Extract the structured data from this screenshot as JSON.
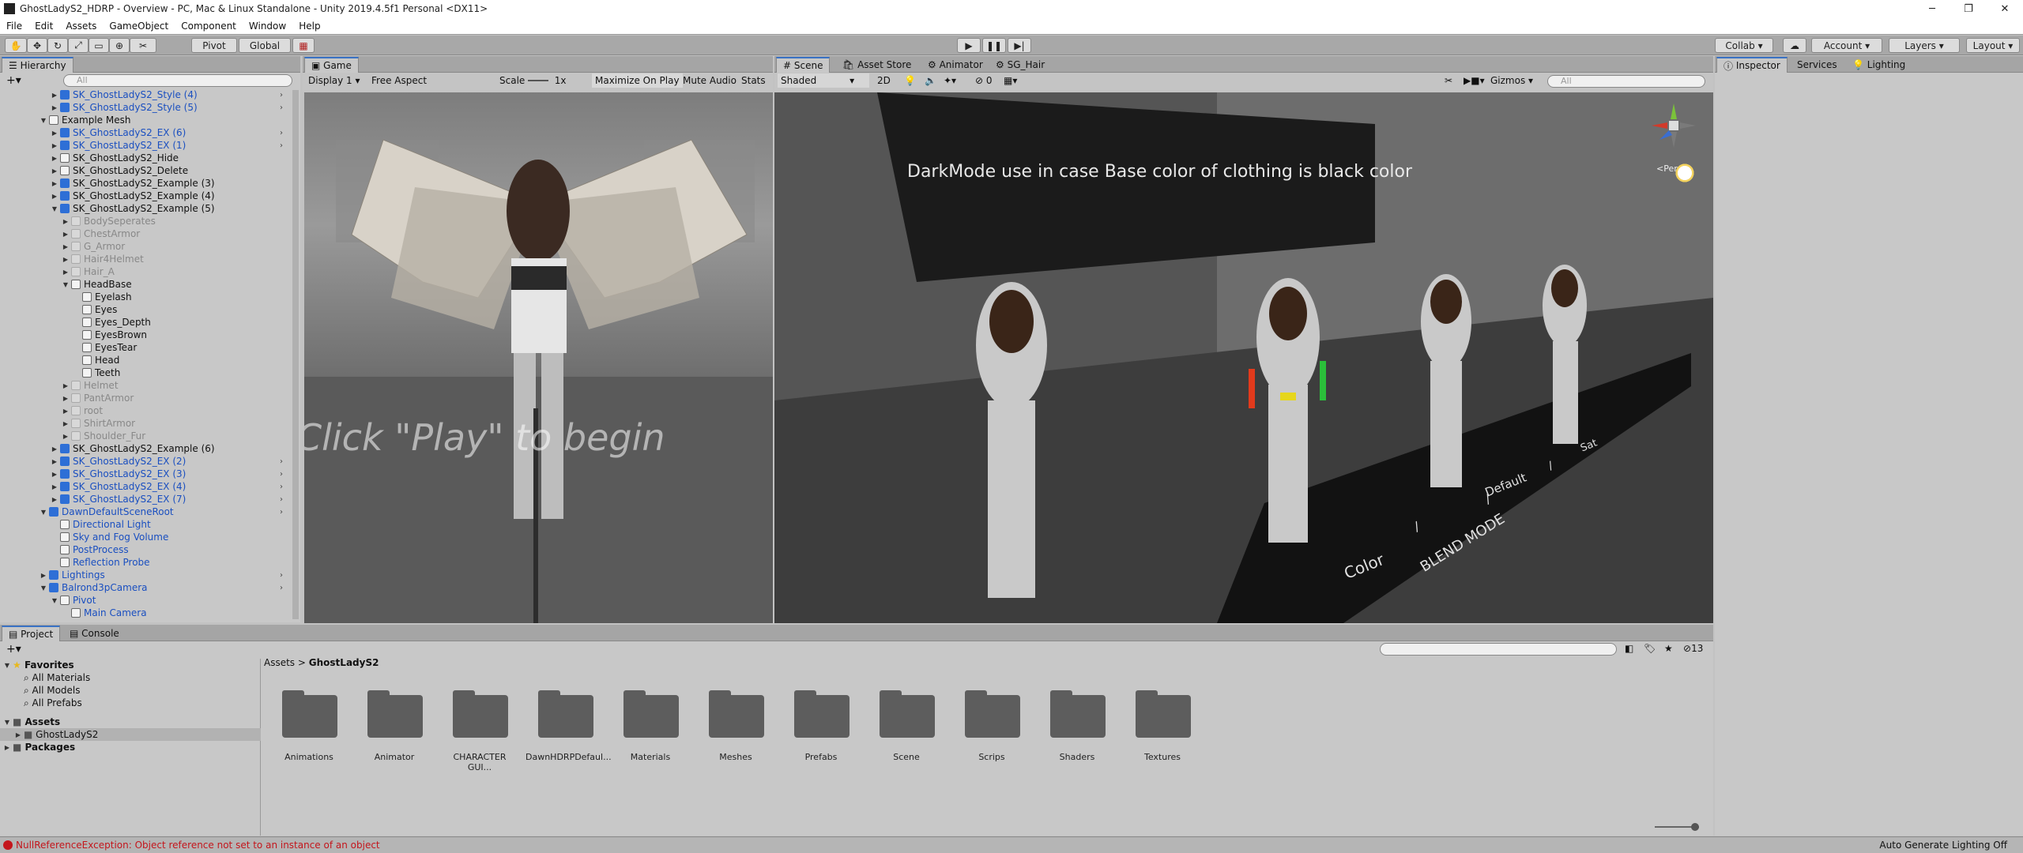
{
  "window": {
    "title": "GhostLadyS2_HDRP - Overview - PC, Mac & Linux Standalone - Unity 2019.4.5f1 Personal <DX11>",
    "controls": [
      "─",
      "❐",
      "✕"
    ]
  },
  "menu": [
    "File",
    "Edit",
    "Assets",
    "GameObject",
    "Component",
    "Window",
    "Help"
  ],
  "toolbar": {
    "pivot": "Pivot",
    "global": "Global",
    "collab": "Collab ▾",
    "account": "Account",
    "layers": "Layers",
    "layout": "Layout"
  },
  "hierarchy": {
    "tab": "Hierarchy",
    "search": "All",
    "rows": [
      {
        "label": "SK_GhostLadyS2_Style (4)",
        "indent": 1,
        "arrow": "▶",
        "color": "blue",
        "icon": "blue",
        "chev": true
      },
      {
        "label": "SK_GhostLadyS2_Style (5)",
        "indent": 1,
        "arrow": "▶",
        "color": "blue",
        "icon": "blue",
        "chev": true
      },
      {
        "label": "Example Mesh",
        "indent": 0,
        "arrow": "▼",
        "color": "black",
        "icon": "white",
        "chev": false
      },
      {
        "label": "SK_GhostLadyS2_EX (6)",
        "indent": 1,
        "arrow": "▶",
        "color": "blue",
        "icon": "blue",
        "chev": true
      },
      {
        "label": "SK_GhostLadyS2_EX (1)",
        "indent": 1,
        "arrow": "▶",
        "color": "blue",
        "icon": "blue",
        "chev": true
      },
      {
        "label": "SK_GhostLadyS2_Hide",
        "indent": 1,
        "arrow": "▶",
        "color": "black",
        "icon": "white",
        "chev": false
      },
      {
        "label": "SK_GhostLadyS2_Delete",
        "indent": 1,
        "arrow": "▶",
        "color": "black",
        "icon": "white",
        "chev": false
      },
      {
        "label": "SK_GhostLadyS2_Example (3)",
        "indent": 1,
        "arrow": "▶",
        "color": "black",
        "icon": "blue",
        "chev": false
      },
      {
        "label": "SK_GhostLadyS2_Example (4)",
        "indent": 1,
        "arrow": "▶",
        "color": "black",
        "icon": "blue",
        "chev": false
      },
      {
        "label": "SK_GhostLadyS2_Example (5)",
        "indent": 1,
        "arrow": "▼",
        "color": "black",
        "icon": "blue",
        "chev": false
      },
      {
        "label": "BodySeperates",
        "indent": 2,
        "arrow": "▶",
        "color": "grey",
        "icon": "grey",
        "chev": false
      },
      {
        "label": "ChestArmor",
        "indent": 2,
        "arrow": "▶",
        "color": "grey",
        "icon": "grey",
        "chev": false
      },
      {
        "label": "G_Armor",
        "indent": 2,
        "arrow": "▶",
        "color": "grey",
        "icon": "grey",
        "chev": false
      },
      {
        "label": "Hair4Helmet",
        "indent": 2,
        "arrow": "▶",
        "color": "grey",
        "icon": "grey",
        "chev": false
      },
      {
        "label": "Hair_A",
        "indent": 2,
        "arrow": "▶",
        "color": "grey",
        "icon": "grey",
        "chev": false
      },
      {
        "label": "HeadBase",
        "indent": 2,
        "arrow": "▼",
        "color": "black",
        "icon": "white",
        "chev": false
      },
      {
        "label": "Eyelash",
        "indent": 3,
        "arrow": "",
        "color": "black",
        "icon": "white",
        "chev": false
      },
      {
        "label": "Eyes",
        "indent": 3,
        "arrow": "",
        "color": "black",
        "icon": "white",
        "chev": false
      },
      {
        "label": "Eyes_Depth",
        "indent": 3,
        "arrow": "",
        "color": "black",
        "icon": "white",
        "chev": false
      },
      {
        "label": "EyesBrown",
        "indent": 3,
        "arrow": "",
        "color": "black",
        "icon": "white",
        "chev": false
      },
      {
        "label": "EyesTear",
        "indent": 3,
        "arrow": "",
        "color": "black",
        "icon": "white",
        "chev": false
      },
      {
        "label": "Head",
        "indent": 3,
        "arrow": "",
        "color": "black",
        "icon": "white",
        "chev": false
      },
      {
        "label": "Teeth",
        "indent": 3,
        "arrow": "",
        "color": "black",
        "icon": "white",
        "chev": false
      },
      {
        "label": "Helmet",
        "indent": 2,
        "arrow": "▶",
        "color": "grey",
        "icon": "grey",
        "chev": false
      },
      {
        "label": "PantArmor",
        "indent": 2,
        "arrow": "▶",
        "color": "grey",
        "icon": "grey",
        "chev": false
      },
      {
        "label": "root",
        "indent": 2,
        "arrow": "▶",
        "color": "grey",
        "icon": "grey",
        "chev": false
      },
      {
        "label": "ShirtArmor",
        "indent": 2,
        "arrow": "▶",
        "color": "grey",
        "icon": "grey",
        "chev": false
      },
      {
        "label": "Shoulder_Fur",
        "indent": 2,
        "arrow": "▶",
        "color": "grey",
        "icon": "grey",
        "chev": false
      },
      {
        "label": "SK_GhostLadyS2_Example (6)",
        "indent": 1,
        "arrow": "▶",
        "color": "black",
        "icon": "blue",
        "chev": false
      },
      {
        "label": "SK_GhostLadyS2_EX (2)",
        "indent": 1,
        "arrow": "▶",
        "color": "blue",
        "icon": "blue",
        "chev": true
      },
      {
        "label": "SK_GhostLadyS2_EX (3)",
        "indent": 1,
        "arrow": "▶",
        "color": "blue",
        "icon": "blue",
        "chev": true
      },
      {
        "label": "SK_GhostLadyS2_EX (4)",
        "indent": 1,
        "arrow": "▶",
        "color": "blue",
        "icon": "blue",
        "chev": true
      },
      {
        "label": "SK_GhostLadyS2_EX (7)",
        "indent": 1,
        "arrow": "▶",
        "color": "blue",
        "icon": "blue",
        "chev": true
      },
      {
        "label": "DawnDefaultSceneRoot",
        "indent": 0,
        "arrow": "▼",
        "color": "blue",
        "icon": "blue",
        "chev": true
      },
      {
        "label": "Directional Light",
        "indent": 1,
        "arrow": "",
        "color": "blue",
        "icon": "white",
        "chev": false
      },
      {
        "label": "Sky and Fog Volume",
        "indent": 1,
        "arrow": "",
        "color": "blue",
        "icon": "white",
        "chev": false
      },
      {
        "label": "PostProcess",
        "indent": 1,
        "arrow": "",
        "color": "blue",
        "icon": "white",
        "chev": false
      },
      {
        "label": "Reflection Probe",
        "indent": 1,
        "arrow": "",
        "color": "blue",
        "icon": "white",
        "chev": false
      },
      {
        "label": "Lightings",
        "indent": 0,
        "arrow": "▶",
        "color": "blue",
        "icon": "blue",
        "chev": true
      },
      {
        "label": "Balrond3pCamera",
        "indent": 0,
        "arrow": "▼",
        "color": "blue",
        "icon": "blue",
        "chev": true
      },
      {
        "label": "Pivot",
        "indent": 1,
        "arrow": "▼",
        "color": "blue",
        "icon": "white",
        "chev": false
      },
      {
        "label": "Main Camera",
        "indent": 2,
        "arrow": "",
        "color": "blue",
        "icon": "white",
        "chev": false
      }
    ]
  },
  "game": {
    "tab": "Game",
    "display": "Display 1",
    "aspect": "Free Aspect",
    "scale_label": "Scale",
    "scale_value": "1x",
    "maximize": "Maximize On Play",
    "mute": "Mute Audio",
    "stats": "Stats",
    "overlay_text": "Click \"Play\" to begin"
  },
  "scene": {
    "tabs": [
      "Scene",
      "Asset Store",
      "Animator",
      "SG_Hair"
    ],
    "shading": "Shaded",
    "mode2d": "2D",
    "hidden_count": "0",
    "gizmos": "Gizmos",
    "search": "All",
    "persp": "<Persp",
    "banner": "DarkMode use in case Base color of clothing is black color",
    "floor_labels": [
      "Color",
      "/",
      "BLEND MODE",
      "/",
      "Default",
      "/",
      "Sat"
    ]
  },
  "inspector": {
    "tabs": [
      "Inspector",
      "Services",
      "Lighting"
    ]
  },
  "project": {
    "tabs": [
      "Project",
      "Console"
    ],
    "favorites_label": "Favorites",
    "favorites": [
      "All Materials",
      "All Models",
      "All Prefabs"
    ],
    "assets_label": "Assets",
    "assets_child": "GhostLadyS2",
    "packages_label": "Packages",
    "breadcrumb_root": "Assets",
    "breadcrumb_sep": ">",
    "breadcrumb_current": "GhostLadyS2",
    "count": "13",
    "folders": [
      "Animations",
      "Animator",
      "CHARACTER GUI...",
      "DawnHDRPDefaul...",
      "Materials",
      "Meshes",
      "Prefabs",
      "Scene",
      "Scrips",
      "Shaders",
      "Textures"
    ]
  },
  "status": {
    "error": "NullReferenceException: Object reference not set to an instance of an object",
    "right": "Auto Generate Lighting Off"
  },
  "colors": {
    "accent": "#3a72c4",
    "error": "#c4161c",
    "link_blue": "#1a4fc0"
  }
}
